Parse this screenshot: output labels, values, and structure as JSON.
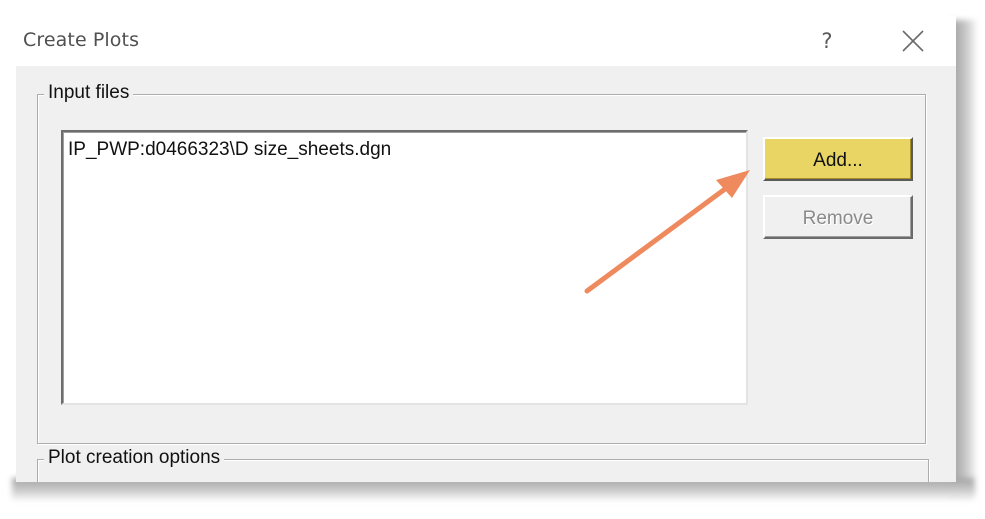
{
  "dialog": {
    "title": "Create Plots",
    "help_label": "?",
    "close_icon": "close-icon"
  },
  "input_files": {
    "group_label": "Input files",
    "items": [
      "IP_PWP:d0466323\\D size_sheets.dgn"
    ],
    "add_label": "Add...",
    "remove_label": "Remove",
    "add_color": "#e8d564"
  },
  "plot_options": {
    "group_label": "Plot creation options"
  },
  "annotation": {
    "arrow_icon": "pointer-arrow-icon",
    "arrow_color": "#ee8a5e"
  }
}
